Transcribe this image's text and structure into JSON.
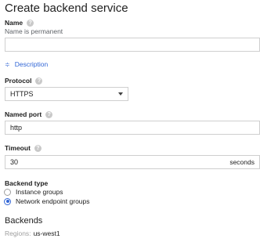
{
  "header": {
    "title": "Create backend service"
  },
  "name": {
    "label": "Name",
    "help_icon": "help-circle-icon",
    "hint": "Name is permanent",
    "value": ""
  },
  "description": {
    "toggle_label": "Description",
    "toggle_icon": "chevron-double-down-icon"
  },
  "protocol": {
    "label": "Protocol",
    "help_icon": "help-circle-icon",
    "selected": "HTTPS"
  },
  "named_port": {
    "label": "Named port",
    "help_icon": "help-circle-icon",
    "value": "http"
  },
  "timeout": {
    "label": "Timeout",
    "help_icon": "help-circle-icon",
    "value": "30",
    "unit": "seconds"
  },
  "backend_type": {
    "label": "Backend type",
    "options": [
      {
        "label": "Instance groups",
        "checked": false
      },
      {
        "label": "Network endpoint groups",
        "checked": true
      }
    ]
  },
  "backends": {
    "title": "Backends",
    "regions_label": "Regions:",
    "regions_value": "us-west1"
  },
  "colors": {
    "accent": "#3367d6",
    "text": "#212121",
    "border": "#cfcfcf",
    "muted": "#9e9e9e"
  }
}
